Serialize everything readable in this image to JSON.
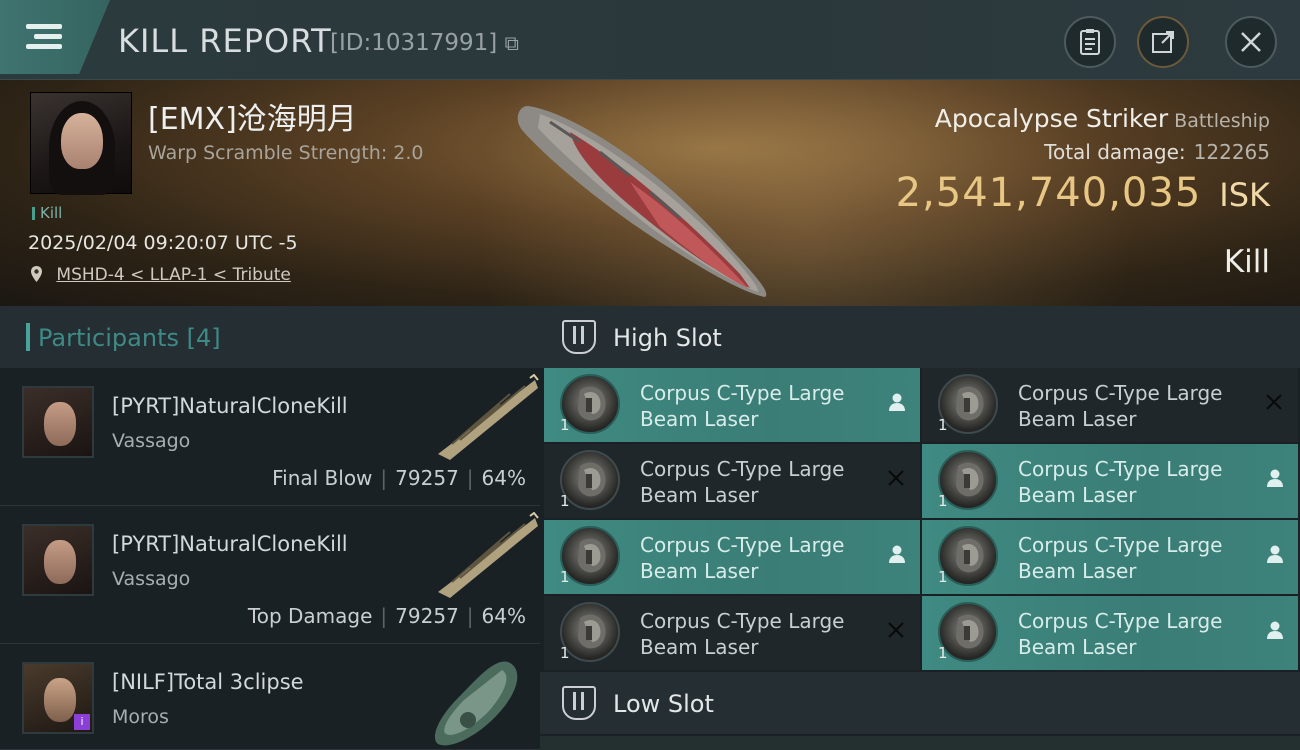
{
  "header": {
    "title": "KILL REPORT",
    "report_id": "[ID:10317991]",
    "copy_icon": "copy-icon",
    "icons": [
      "clipboard-icon",
      "share-icon",
      "close-icon"
    ]
  },
  "victim": {
    "name": "[EMX]沧海明月",
    "warp_scramble": "Warp Scramble Strength: 2.0",
    "tag": "Kill",
    "datetime": "2025/02/04 09:20:07 UTC -5",
    "location": "MSHD-4 < LLAP-1 < Tribute",
    "ship_name": "Apocalypse Striker",
    "ship_class": "Battleship",
    "total_damage_label": "Total damage:",
    "total_damage": "122265",
    "isk_value": "2,541,740,035",
    "isk_unit": "ISK",
    "result": "Kill"
  },
  "participants": {
    "label": "Participants",
    "count": "[4]",
    "rows": [
      {
        "name": "[PYRT]NaturalCloneKill",
        "ship": "Vassago",
        "role": "Final Blow",
        "damage": "79257",
        "percent": "64%"
      },
      {
        "name": "[PYRT]NaturalCloneKill",
        "ship": "Vassago",
        "role": "Top Damage",
        "damage": "79257",
        "percent": "64%"
      },
      {
        "name": "[NILF]Total 3clipse",
        "ship": "Moros",
        "role": "",
        "damage": "",
        "percent": ""
      }
    ]
  },
  "slots": {
    "high": {
      "label": "High Slot",
      "modules": [
        {
          "name": "Corpus C-Type Large Beam Laser",
          "qty": "1",
          "state": "dropped"
        },
        {
          "name": "Corpus C-Type Large Beam Laser",
          "qty": "1",
          "state": "destroyed"
        },
        {
          "name": "Corpus C-Type Large Beam Laser",
          "qty": "1",
          "state": "destroyed"
        },
        {
          "name": "Corpus C-Type Large Beam Laser",
          "qty": "1",
          "state": "dropped"
        },
        {
          "name": "Corpus C-Type Large Beam Laser",
          "qty": "1",
          "state": "dropped"
        },
        {
          "name": "Corpus C-Type Large Beam Laser",
          "qty": "1",
          "state": "dropped"
        },
        {
          "name": "Corpus C-Type Large Beam Laser",
          "qty": "1",
          "state": "destroyed"
        },
        {
          "name": "Corpus C-Type Large Beam Laser",
          "qty": "1",
          "state": "dropped"
        }
      ]
    },
    "low": {
      "label": "Low Slot"
    }
  },
  "colors": {
    "accent": "#3f8a82",
    "isk_gold": "#e8c785",
    "panel_dark": "#1a2125"
  }
}
